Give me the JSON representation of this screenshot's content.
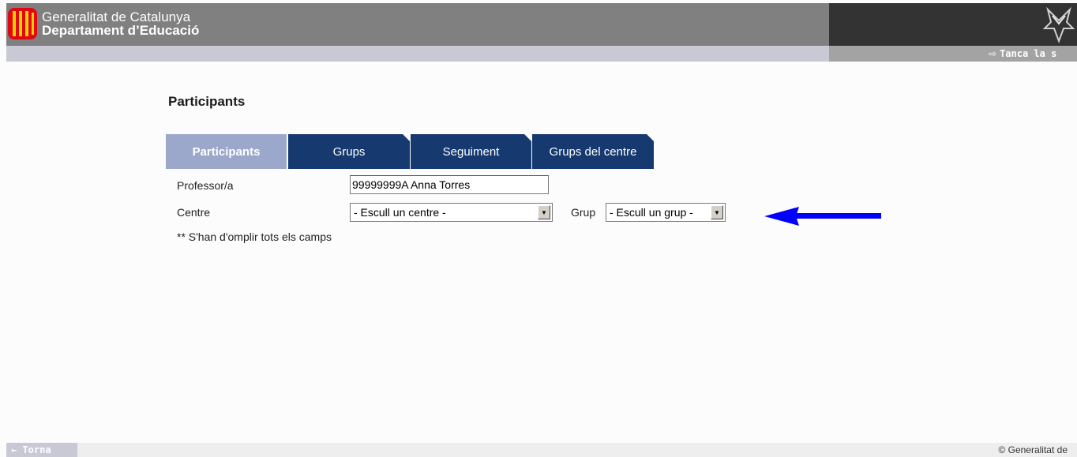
{
  "header": {
    "line1": "Generalitat de Catalunya",
    "line2": "Departament d’Educació",
    "logout_label": "Tanca la s",
    "logout_icon": "exit-arrow-icon"
  },
  "page": {
    "title": "Participants"
  },
  "tabs": [
    {
      "label": "Participants",
      "active": true
    },
    {
      "label": "Grups",
      "active": false
    },
    {
      "label": "Seguiment",
      "active": false
    },
    {
      "label": "Grups del centre",
      "active": false
    }
  ],
  "form": {
    "professor_label": "Professor/a",
    "professor_value": "99999999A Anna Torres",
    "centre_label": "Centre",
    "centre_selected": "- Escull un centre -",
    "grup_label": "Grup",
    "grup_selected": "- Escull un grup -",
    "note": "** S'han d'omplir tots els camps"
  },
  "annotation": {
    "arrow_color": "#0000ff"
  },
  "footer": {
    "back_label": "← Torna",
    "copyright": "© Generalitat de"
  },
  "colors": {
    "header_gray": "#808080",
    "header_dark": "#333333",
    "tab_active": "#9ba8cc",
    "tab_inactive": "#163a70"
  }
}
